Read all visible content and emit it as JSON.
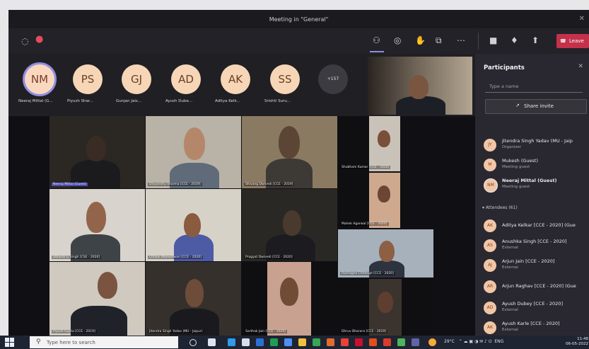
{
  "window": {
    "title": "Meeting in \"General\""
  },
  "toolbar": {
    "leave_label": "Leave"
  },
  "avatars": [
    {
      "initials": "NM",
      "label": "Neeraj Mittal (G..."
    },
    {
      "initials": "PS",
      "label": "Piyush Shar..."
    },
    {
      "initials": "GJ",
      "label": "Gunjan Jais..."
    },
    {
      "initials": "AD",
      "label": "Ayush Dube..."
    },
    {
      "initials": "AK",
      "label": "Aditya Kelk..."
    },
    {
      "initials": "SS",
      "label": "Srishti Suru..."
    }
  ],
  "overflow_count": "+157",
  "tiles": {
    "t1": "Neeraj Mittal (Guest)",
    "t2": "Divyanshu Sharma [CCE - 2019]",
    "t3": "Shivang Dwivedi [CCE - 2019]",
    "t4": "Shubham Kumar [CCE - 2020]",
    "t5": "Utkarsh G Singh [CSE - 2020]",
    "t6": "Chhavi Maheshwari [CCE - 2020]",
    "t7": "Pragyat Dwivedi [CCE - 2020]",
    "t8": "Mahek Agarwal [CCE - 2020]",
    "t9": "Rachagno Chhenge [CCE - 2020]",
    "t10": "Piyush Gupta [CCE - 2019]",
    "t11": "Jitendra Singh Yadav (MU - Jaipur)",
    "t12": "Sarthak Jain [CCE - 2020]",
    "t13": "Dhruv Bharara [CCE - 2019]"
  },
  "panel": {
    "title": "Participants",
    "search_placeholder": "Type a name",
    "share_label": "Share invite",
    "attendees_label": "Attendees (61)",
    "items": [
      {
        "initials": "JY",
        "name": "Jitendra Singh Yadav (MU - Jaip",
        "role": "Organizer"
      },
      {
        "initials": "M",
        "name": "Mukesh (Guest)",
        "role": "Meeting guest"
      },
      {
        "initials": "NM",
        "name": "Neeraj Mittal (Guest)",
        "role": "Meeting guest"
      },
      {
        "initials": "AK",
        "name": "Aditya Kelkar [CCE - 2020] (Gue",
        "role": ""
      },
      {
        "initials": "AS",
        "name": "Anushka Singh [CCE - 2020]",
        "role": "External"
      },
      {
        "initials": "AJ",
        "name": "Arjun Jain [CCE - 2020]",
        "role": "External"
      },
      {
        "initials": "AR",
        "name": "Arjun Raghav [CCE - 2020] (Gue",
        "role": ""
      },
      {
        "initials": "AD",
        "name": "Ayush Dubey [CCE - 2020]",
        "role": "External"
      },
      {
        "initials": "AK",
        "name": "Ayush Karle [CCE - 2020]",
        "role": "External"
      }
    ]
  },
  "taskbar": {
    "search_placeholder": "Type here to search",
    "weather": "29°C",
    "lang": "ENG",
    "time": "11:48",
    "date": "06-05-2022"
  },
  "colors": {
    "leave": "#c4314b",
    "accent": "#8f8fe0",
    "panel": "#292830"
  }
}
